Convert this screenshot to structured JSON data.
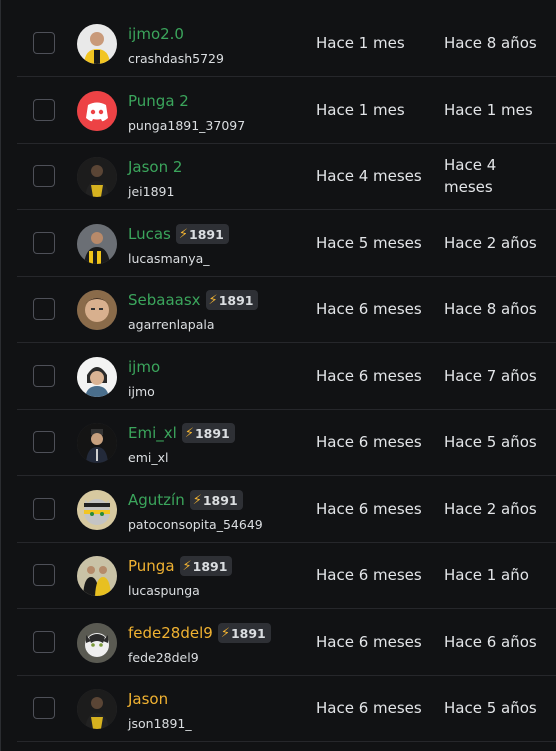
{
  "colors": {
    "green": "#3ba55c",
    "gold": "#f0b232",
    "discord": "#ed4245",
    "background": "#111214"
  },
  "members": [
    {
      "display_name": "ijmo2.0",
      "username": "crashdash5729",
      "joined_server": "Hace 1 mes",
      "joined_discord": "Hace 8 años",
      "name_color": "#3ba55c",
      "badge": null,
      "avatar": "photo-person-jersey-avatar"
    },
    {
      "display_name": "Punga 2",
      "username": "punga1891_37097",
      "joined_server": "Hace 1 mes",
      "joined_discord": "Hace 1 mes",
      "name_color": "#3ba55c",
      "badge": null,
      "avatar": "discord-default-avatar"
    },
    {
      "display_name": "Jason 2",
      "username": "jei1891",
      "joined_server": "Hace 4 meses",
      "joined_discord": "Hace 4 meses",
      "name_color": "#3ba55c",
      "badge": null,
      "avatar": "photo-dark-player-avatar"
    },
    {
      "display_name": "Lucas",
      "username": "lucasmanya_",
      "joined_server": "Hace 5 meses",
      "joined_discord": "Hace 2 años",
      "name_color": "#3ba55c",
      "badge": "1891",
      "avatar": "photo-player-avatar"
    },
    {
      "display_name": "Sebaaasx",
      "username": "agarrenlapala",
      "joined_server": "Hace 6 meses",
      "joined_discord": "Hace 8 años",
      "name_color": "#3ba55c",
      "badge": "1891",
      "avatar": "photo-face-avatar"
    },
    {
      "display_name": "ijmo",
      "username": "ijmo",
      "joined_server": "Hace 6 meses",
      "joined_discord": "Hace 7 años",
      "name_color": "#3ba55c",
      "badge": null,
      "avatar": "photo-person-light-avatar"
    },
    {
      "display_name": "Emi_xl",
      "username": "emi_xl",
      "joined_server": "Hace 6 meses",
      "joined_discord": "Hace 5 años",
      "name_color": "#3ba55c",
      "badge": "1891",
      "avatar": "photo-figure-dark-avatar"
    },
    {
      "display_name": "Agutzín",
      "username": "patoconsopita_54649",
      "joined_server": "Hace 6 meses",
      "joined_discord": "Hace 2 años",
      "name_color": "#3ba55c",
      "badge": "1891",
      "avatar": "photo-striped-cat-avatar"
    },
    {
      "display_name": "Punga",
      "username": "lucaspunga",
      "joined_server": "Hace 6 meses",
      "joined_discord": "Hace 1 año",
      "name_color": "#f0b232",
      "badge": "1891",
      "avatar": "photo-team-avatar"
    },
    {
      "display_name": "fede28del9",
      "username": "fede28del9",
      "joined_server": "Hace 6 meses",
      "joined_discord": "Hace 6 años",
      "name_color": "#f0b232",
      "badge": "1891",
      "avatar": "photo-cat-avatar"
    },
    {
      "display_name": "Jason",
      "username": "json1891_",
      "joined_server": "Hace 6 meses",
      "joined_discord": "Hace 5 años",
      "name_color": "#f0b232",
      "badge": null,
      "avatar": "photo-dark-player-avatar"
    }
  ]
}
